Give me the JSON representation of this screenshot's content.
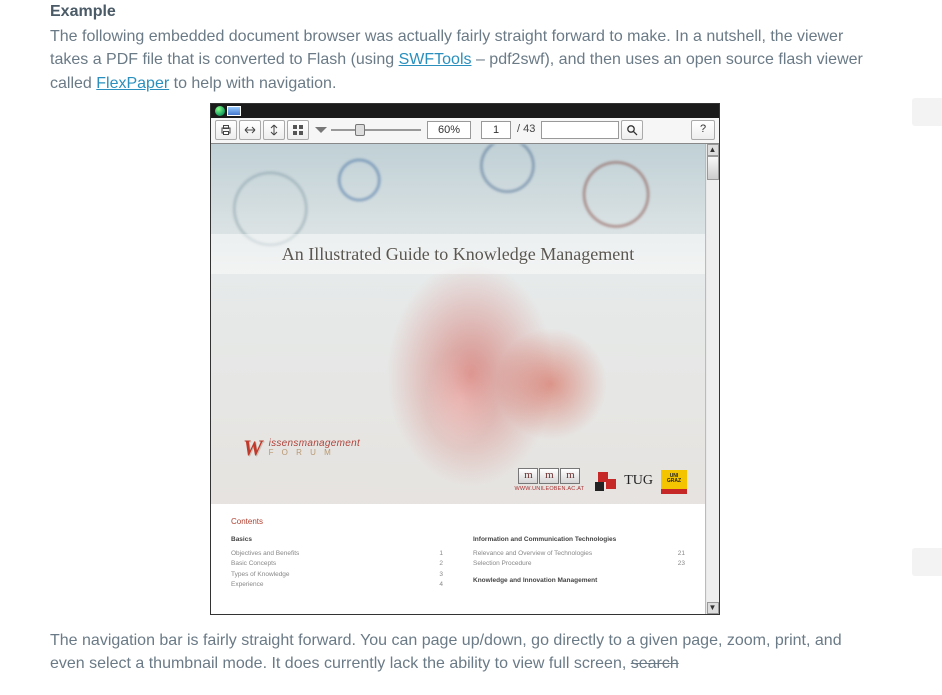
{
  "article": {
    "heading": "Example",
    "p1a": "The following embedded document browser was actually fairly straight forward to make. In a nutshell, the viewer takes a PDF file that is converted to Flash (using ",
    "link1": "SWFTools",
    "p1b": " – pdf2swf), and then uses an open source flash viewer called ",
    "link2": "FlexPaper",
    "p1c": " to help with navigation.",
    "p2a": "The navigation bar is fairly straight forward. You can page up/down, go directly to a given page, zoom, print, and even select a thumbnail mode. It does currently lack the ability to view full screen, ",
    "p2strike": "search"
  },
  "viewer": {
    "toolbar": {
      "zoom": "60%",
      "page": "1",
      "total": "/ 43",
      "help": "?"
    },
    "cover": {
      "title": "An Illustrated Guide to Knowledge Management",
      "wm_line1": "issensmanagement",
      "wm_line2": "F o r u m",
      "m_url": "WWW.UNILEOBEN.AC.AT",
      "tug": "TUG",
      "uni1": "UNI",
      "uni2": "GRAZ"
    },
    "contents": {
      "title": "Contents",
      "col1_head": "Basics",
      "col1": [
        {
          "t": "Objectives and Benefits",
          "p": "1"
        },
        {
          "t": "Basic Concepts",
          "p": "2"
        },
        {
          "t": "Types of Knowledge",
          "p": "3"
        },
        {
          "t": "Experience",
          "p": "4"
        }
      ],
      "col2_head": "Information and Communication Technologies",
      "col2": [
        {
          "t": "Relevance and Overview of Technologies",
          "p": "21"
        },
        {
          "t": "Selection Procedure",
          "p": "23"
        }
      ],
      "col2_head2": "Knowledge and Innovation Management"
    }
  }
}
